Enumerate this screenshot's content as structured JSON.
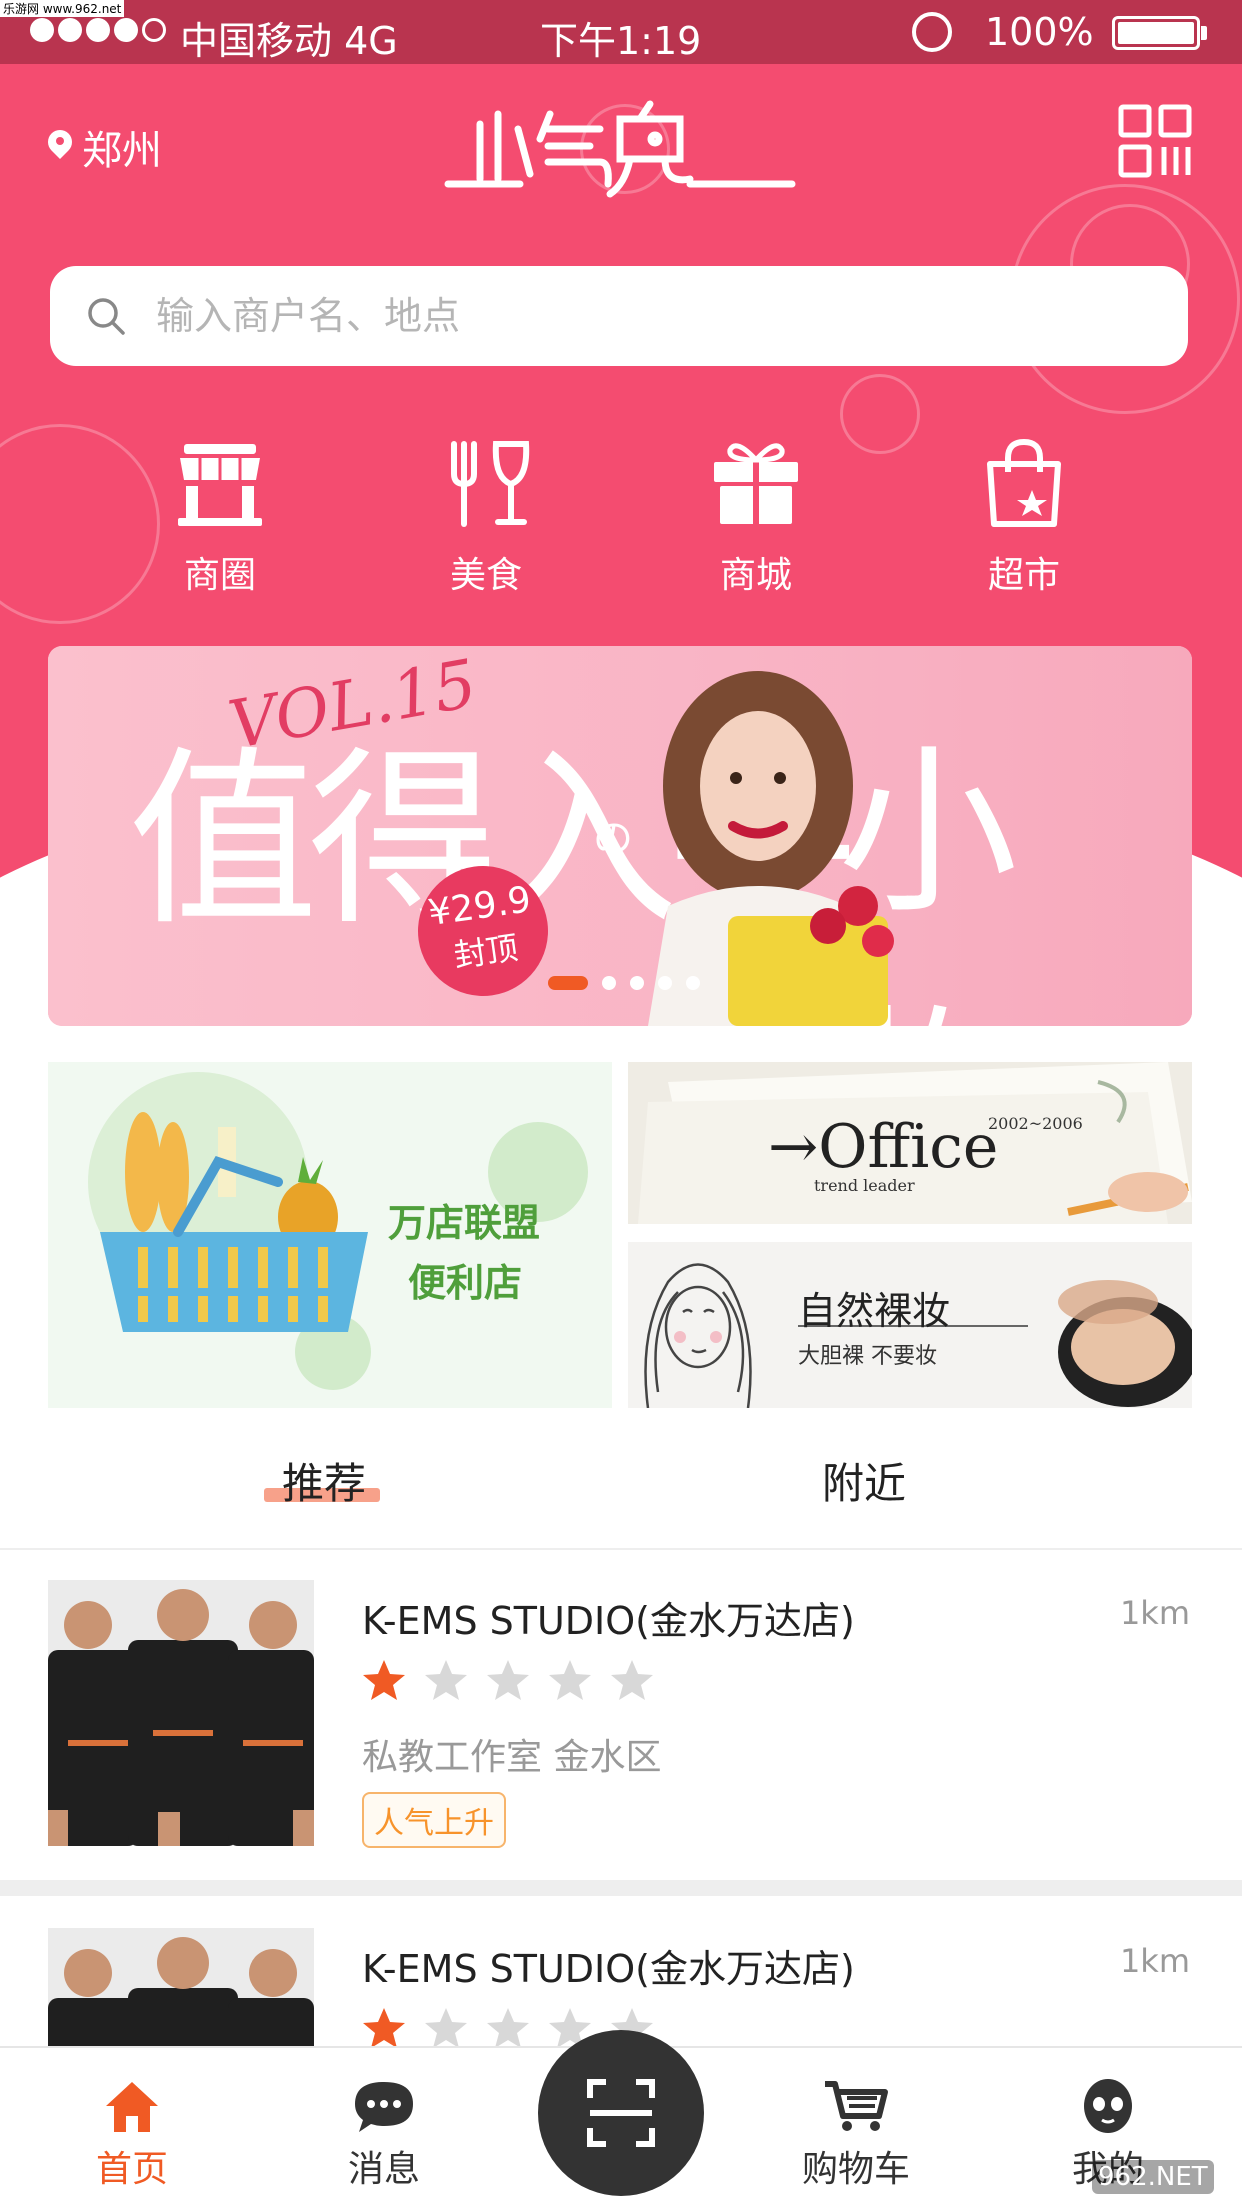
{
  "watermark": {
    "top": "乐游网 www.962.net",
    "bottom": "962.NET"
  },
  "status_bar": {
    "carrier": "中国移动  4G",
    "time": "下午1:19",
    "battery": "100%"
  },
  "header": {
    "location": "郑州",
    "logo": "小气鬼",
    "search_placeholder": "输入商户名、地点"
  },
  "categories": [
    {
      "label": "商圈",
      "icon": "store-icon"
    },
    {
      "label": "美食",
      "icon": "utensils-icon"
    },
    {
      "label": "商城",
      "icon": "gift-icon"
    },
    {
      "label": "超市",
      "icon": "shopping-bag-icon"
    }
  ],
  "banner": {
    "vol": "VOL.15",
    "title_a": "值得入手",
    "title_b": "小物",
    "no_char": "の",
    "price": "¥29.9",
    "price_sub": "封顶",
    "dots": 5,
    "active_dot": 0
  },
  "promos": {
    "left": {
      "line1": "万店联盟",
      "line2": "便利店"
    },
    "right_top": {
      "word": "→Office",
      "years": "2002~2006",
      "sub": "trend leader"
    },
    "right_bottom": {
      "title": "自然裸妆",
      "sub": "大胆裸  不要妆"
    }
  },
  "tabs": [
    {
      "label": "推荐",
      "active": true
    },
    {
      "label": "附近",
      "active": false
    }
  ],
  "stores": [
    {
      "name": "K-EMS STUDIO(金水万达店)",
      "distance": "1km",
      "rating": 1,
      "max_rating": 5,
      "meta": "私教工作室   金水区",
      "tag": "人气上升"
    },
    {
      "name": "K-EMS STUDIO(金水万达店)",
      "distance": "1km",
      "rating": 1,
      "max_rating": 5
    }
  ],
  "bottom_nav": [
    {
      "label": "首页",
      "icon": "home-icon",
      "active": true
    },
    {
      "label": "消息",
      "icon": "message-icon",
      "active": false
    },
    {
      "label": "购物车",
      "icon": "cart-icon",
      "active": false
    },
    {
      "label": "我的",
      "icon": "profile-icon",
      "active": false
    }
  ],
  "colors": {
    "brand": "#f44c70",
    "status_bar": "#b9344f",
    "accent_orange": "#f05a24",
    "star_active": "#f05a24",
    "star_inactive": "#d8d8d8"
  }
}
